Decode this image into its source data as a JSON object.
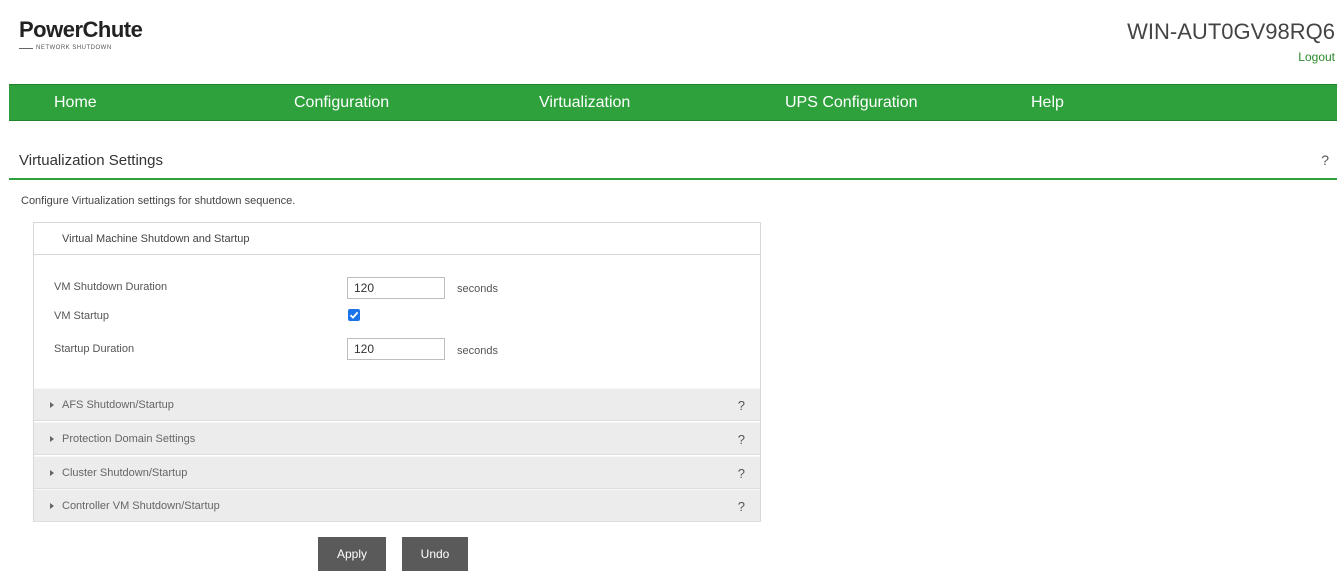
{
  "header": {
    "logo_main": "PowerChute",
    "logo_sub": "NETWORK SHUTDOWN",
    "hostname": "WIN-AUT0GV98RQ6",
    "logout_label": "Logout"
  },
  "nav": {
    "items": [
      {
        "label": "Home"
      },
      {
        "label": "Configuration"
      },
      {
        "label": "Virtualization"
      },
      {
        "label": "UPS Configuration"
      },
      {
        "label": "Help"
      }
    ]
  },
  "page": {
    "title": "Virtualization Settings",
    "help": "?",
    "description": "Configure Virtualization settings for shutdown sequence."
  },
  "panel": {
    "header": "Virtual Machine Shutdown and Startup",
    "fields": {
      "vm_shutdown_duration": {
        "label": "VM Shutdown Duration",
        "value": "120",
        "unit": "seconds"
      },
      "vm_startup": {
        "label": "VM Startup",
        "checked": true
      },
      "startup_duration": {
        "label": "Startup Duration",
        "value": "120",
        "unit": "seconds"
      }
    },
    "sections": [
      {
        "label": "AFS Shutdown/Startup",
        "help": "?"
      },
      {
        "label": "Protection Domain Settings",
        "help": "?"
      },
      {
        "label": "Cluster Shutdown/Startup",
        "help": "?"
      },
      {
        "label": "Controller VM Shutdown/Startup",
        "help": "?"
      }
    ]
  },
  "actions": {
    "apply_label": "Apply",
    "undo_label": "Undo"
  },
  "colors": {
    "brand_green": "#2ea13c",
    "button_gray": "#5a5a5a",
    "checkbox_blue": "#1a73e8"
  }
}
